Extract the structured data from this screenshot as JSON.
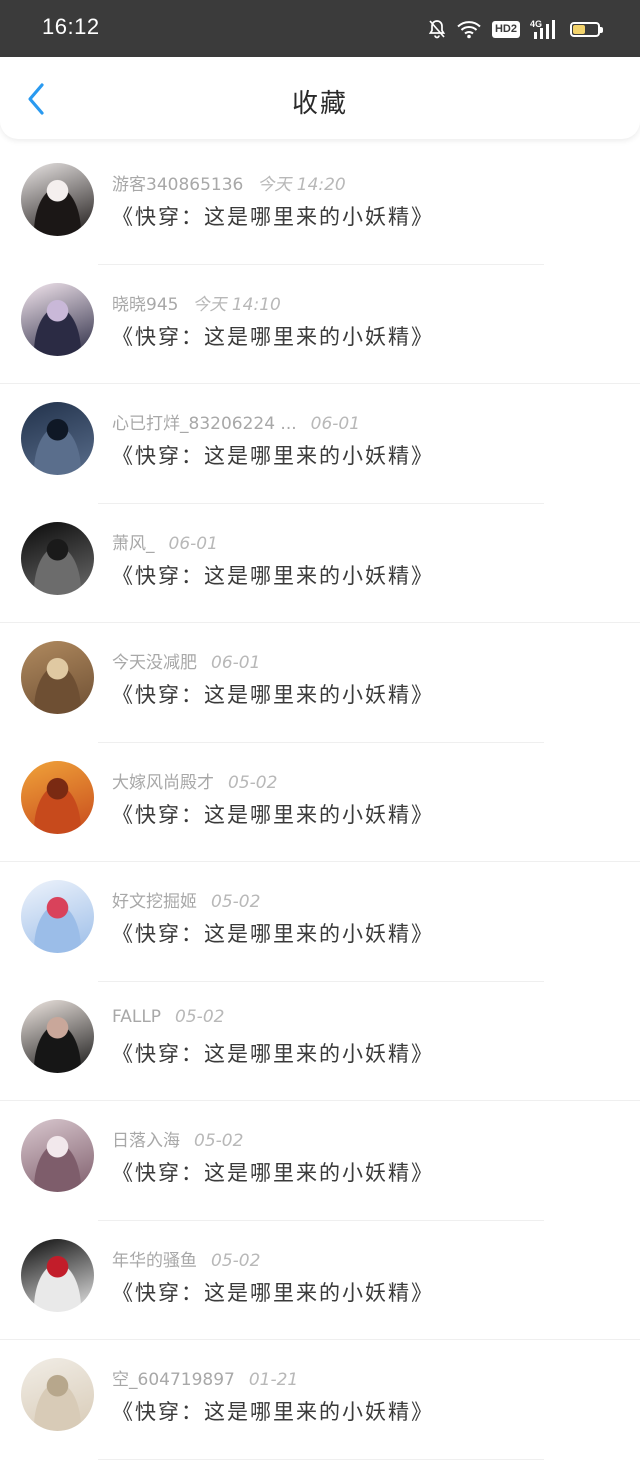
{
  "status_bar": {
    "time": "16:12",
    "hd_badge": "HD2",
    "network": "4G",
    "battery_level": 0.55,
    "battery_color": "#f3d36b"
  },
  "header": {
    "title": "收藏",
    "back_icon": "chevron-left-icon",
    "accent": "#2a9af0"
  },
  "list": [
    {
      "username": "游客340865136",
      "date": "今天 14:20",
      "text": "《快穿：这是哪里来的小妖精》",
      "avatar_colors": [
        "#e9e5e4",
        "#1b1716",
        "#f4efee"
      ]
    },
    {
      "username": "晓晓945",
      "date": "今天 14:10",
      "text": "《快穿：这是哪里来的小妖精》",
      "avatar_colors": [
        "#f3e6ee",
        "#2b2b44",
        "#c9b8d8"
      ]
    },
    {
      "username": "心已打烊_83206224 ...",
      "date": "06-01",
      "text": "《快穿：这是哪里来的小妖精》",
      "avatar_colors": [
        "#22324b",
        "#5a6e8c",
        "#0f1826"
      ]
    },
    {
      "username": "萧风_",
      "date": "06-01",
      "text": "《快穿：这是哪里来的小妖精》",
      "avatar_colors": [
        "#0b0b0b",
        "#6c6c6c",
        "#1a1a1a"
      ]
    },
    {
      "username": "今天没减肥",
      "date": "06-01",
      "text": "《快穿：这是哪里来的小妖精》",
      "avatar_colors": [
        "#b08a5f",
        "#6e4f33",
        "#e0c9a2"
      ]
    },
    {
      "username": "大嫁风尚殿才",
      "date": "05-02",
      "text": "《快穿：这是哪里来的小妖精》",
      "avatar_colors": [
        "#f0a33a",
        "#c74a1c",
        "#7a2a12"
      ]
    },
    {
      "username": "好文挖掘姬",
      "date": "05-02",
      "text": "《快穿：这是哪里来的小妖精》",
      "avatar_colors": [
        "#eef3fb",
        "#9bbde8",
        "#d9425b"
      ]
    },
    {
      "username": "FALLP",
      "date": "05-02",
      "text": "《快穿：这是哪里来的小妖精》",
      "avatar_colors": [
        "#efe7e2",
        "#161616",
        "#c9a79a"
      ]
    },
    {
      "username": "日落入海",
      "date": "05-02",
      "text": "《快穿：这是哪里来的小妖精》",
      "avatar_colors": [
        "#d9c8cf",
        "#7e5d6b",
        "#f2e8ec"
      ]
    },
    {
      "username": "年华的骚鱼",
      "date": "05-02",
      "text": "《快穿：这是哪里来的小妖精》",
      "avatar_colors": [
        "#0d0d0d",
        "#e9e9e9",
        "#c21d2a"
      ]
    },
    {
      "username": "空_604719897",
      "date": "01-21",
      "text": "《快穿：这是哪里来的小妖精》",
      "avatar_colors": [
        "#f1ede6",
        "#d8cbb7",
        "#b7a78c"
      ]
    }
  ]
}
